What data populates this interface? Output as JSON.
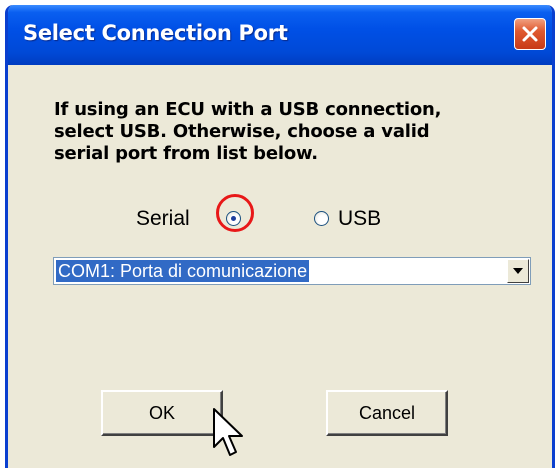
{
  "window": {
    "title": "Select Connection Port",
    "close_icon": "close-x-icon"
  },
  "instructions": {
    "line1": "If using an ECU with a USB connection,",
    "line2": "select USB. Otherwise, choose a valid",
    "line3": "serial port from list below."
  },
  "connection_type": {
    "options": [
      {
        "label": "Serial",
        "selected": true
      },
      {
        "label": "USB",
        "selected": false
      }
    ],
    "highlight_color": "#e81818"
  },
  "port_select": {
    "selected_value": "COM1: Porta di comunicazione"
  },
  "buttons": {
    "ok_label": "OK",
    "cancel_label": "Cancel"
  },
  "colors": {
    "titlebar": "#0050e6",
    "dialog_bg": "#ece9d8",
    "selection": "#316ac5"
  },
  "cursor_icon": "arrow-pointer-icon"
}
